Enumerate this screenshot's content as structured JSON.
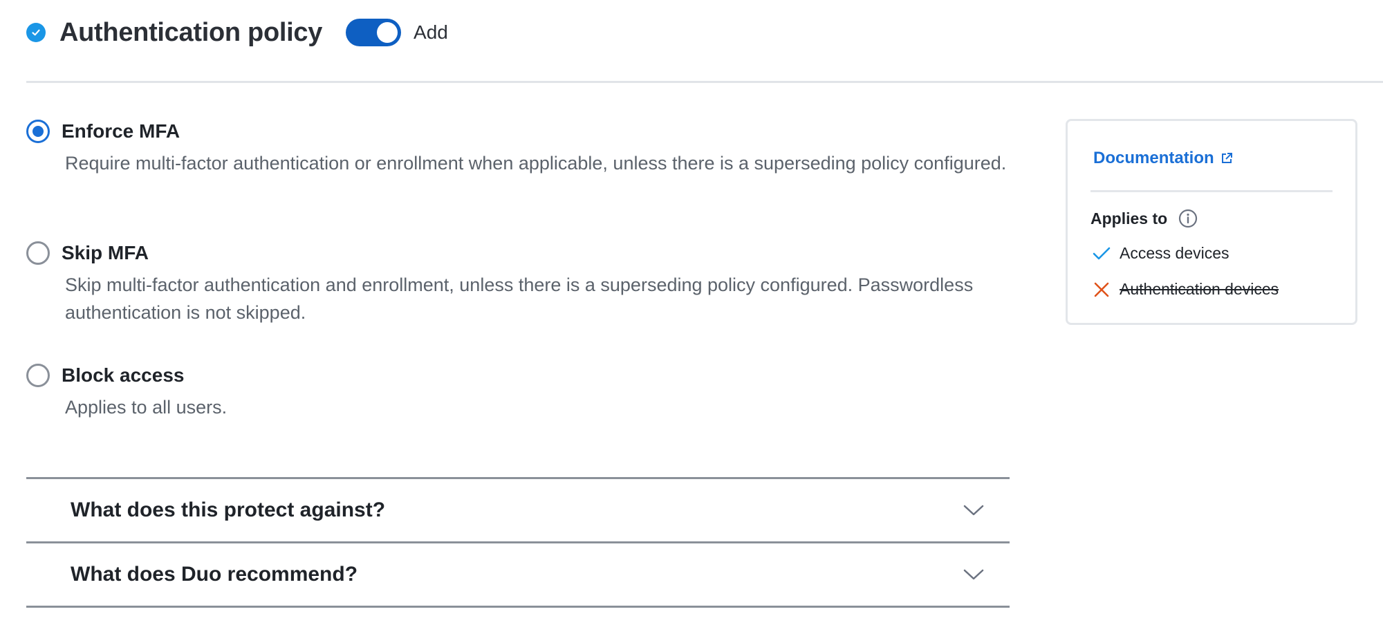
{
  "header": {
    "title": "Authentication policy",
    "toggle_label": "Add",
    "toggle_on": true
  },
  "options": [
    {
      "label": "Enforce MFA",
      "description": "Require multi-factor authentication or enrollment when applicable, unless there is a superseding policy configured.",
      "selected": true
    },
    {
      "label": "Skip MFA",
      "description": "Skip multi-factor authentication and enrollment, unless there is a superseding policy configured. Passwordless authentication is not skipped.",
      "selected": false
    },
    {
      "label": "Block access",
      "description": "Applies to all users.",
      "selected": false
    }
  ],
  "accordions": [
    {
      "title": "What does this protect against?"
    },
    {
      "title": "What does Duo recommend?"
    }
  ],
  "sidebar": {
    "doc_link": "Documentation",
    "applies_title": "Applies to",
    "applies": [
      {
        "label": "Access devices",
        "applies": true,
        "icon": "check-icon"
      },
      {
        "label": "Authentication devices",
        "applies": false,
        "icon": "x-icon"
      }
    ]
  },
  "colors": {
    "accent": "#1a6fd6",
    "toggle": "#0e5fc2",
    "status_dot": "#1a96e6",
    "check": "#1a96e6",
    "cross": "#e0521a"
  }
}
